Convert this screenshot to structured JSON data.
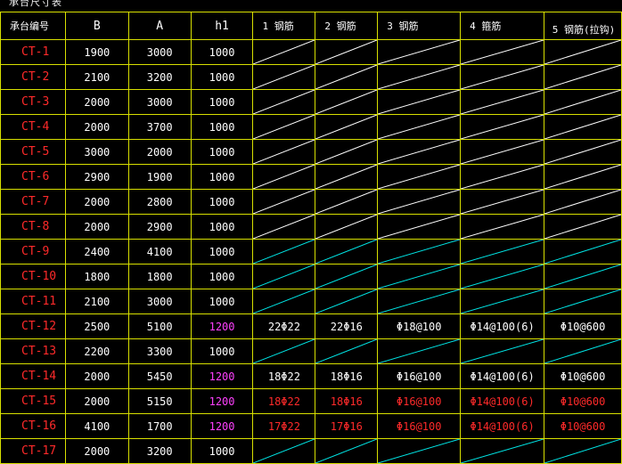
{
  "caption": "承台尺寸表",
  "headers": [
    "承台编号",
    "B",
    "A",
    "h1",
    "1 钢筋",
    "2 钢筋",
    "3 钢筋",
    "4 箍筋",
    "5 钢筋(拉钩)"
  ],
  "colors": {
    "grid": "#d8e000",
    "id_text": "#ff2a2a",
    "number_text": "#ffffff",
    "h1_highlight": "#ff40ff",
    "diag_white": "#ffffff",
    "diag_cyan": "#00e5e5"
  },
  "rows": [
    {
      "id": "CT-1",
      "B": "1900",
      "A": "3000",
      "h1": "1000",
      "h1_mag": false,
      "diag": "white",
      "rebar": null
    },
    {
      "id": "CT-2",
      "B": "2100",
      "A": "3200",
      "h1": "1000",
      "h1_mag": false,
      "diag": "white",
      "rebar": null
    },
    {
      "id": "CT-3",
      "B": "2000",
      "A": "3000",
      "h1": "1000",
      "h1_mag": false,
      "diag": "white",
      "rebar": null
    },
    {
      "id": "CT-4",
      "B": "2000",
      "A": "3700",
      "h1": "1000",
      "h1_mag": false,
      "diag": "white",
      "rebar": null
    },
    {
      "id": "CT-5",
      "B": "3000",
      "A": "2000",
      "h1": "1000",
      "h1_mag": false,
      "diag": "white",
      "rebar": null
    },
    {
      "id": "CT-6",
      "B": "2900",
      "A": "1900",
      "h1": "1000",
      "h1_mag": false,
      "diag": "white",
      "rebar": null
    },
    {
      "id": "CT-7",
      "B": "2000",
      "A": "2800",
      "h1": "1000",
      "h1_mag": false,
      "diag": "white",
      "rebar": null
    },
    {
      "id": "CT-8",
      "B": "2000",
      "A": "2900",
      "h1": "1000",
      "h1_mag": false,
      "diag": "white",
      "rebar": null
    },
    {
      "id": "CT-9",
      "B": "2400",
      "A": "4100",
      "h1": "1000",
      "h1_mag": false,
      "diag": "cyan",
      "rebar": null
    },
    {
      "id": "CT-10",
      "B": "1800",
      "A": "1800",
      "h1": "1000",
      "h1_mag": false,
      "diag": "cyan",
      "rebar": null
    },
    {
      "id": "CT-11",
      "B": "2100",
      "A": "3000",
      "h1": "1000",
      "h1_mag": false,
      "diag": "cyan",
      "rebar": null
    },
    {
      "id": "CT-12",
      "B": "2500",
      "A": "5100",
      "h1": "1200",
      "h1_mag": true,
      "diag": null,
      "rebar_color": "white",
      "rebar": [
        "22Φ22",
        "22Φ16",
        "Φ18@100",
        "Φ14@100(6)",
        "Φ10@600"
      ]
    },
    {
      "id": "CT-13",
      "B": "2200",
      "A": "3300",
      "h1": "1000",
      "h1_mag": false,
      "diag": "cyan",
      "rebar": null
    },
    {
      "id": "CT-14",
      "B": "2000",
      "A": "5450",
      "h1": "1200",
      "h1_mag": true,
      "diag": null,
      "rebar_color": "white",
      "rebar": [
        "18Φ22",
        "18Φ16",
        "Φ16@100",
        "Φ14@100(6)",
        "Φ10@600"
      ]
    },
    {
      "id": "CT-15",
      "B": "2000",
      "A": "5150",
      "h1": "1200",
      "h1_mag": true,
      "diag": null,
      "rebar_color": "red",
      "rebar": [
        "18Φ22",
        "18Φ16",
        "Φ16@100",
        "Φ14@100(6)",
        "Φ10@600"
      ]
    },
    {
      "id": "CT-16",
      "B": "4100",
      "A": "1700",
      "h1": "1200",
      "h1_mag": true,
      "diag": null,
      "rebar_color": "red",
      "rebar": [
        "17Φ22",
        "17Φ16",
        "Φ16@100",
        "Φ14@100(6)",
        "Φ10@600"
      ]
    },
    {
      "id": "CT-17",
      "B": "2000",
      "A": "3200",
      "h1": "1000",
      "h1_mag": false,
      "diag": "cyan",
      "rebar": null
    }
  ]
}
